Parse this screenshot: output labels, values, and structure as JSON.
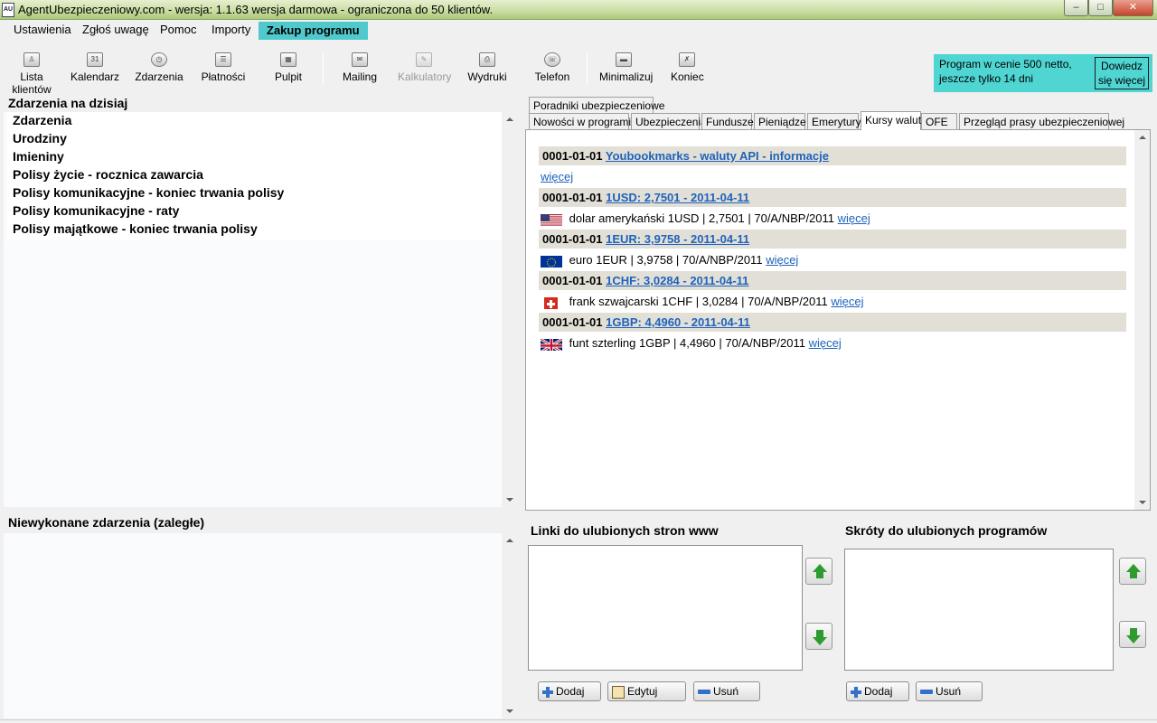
{
  "window": {
    "icon_label": "AU",
    "title": "AgentUbezpieczeniowy.com - wersja: 1.1.63 wersja darmowa - ograniczona do 50 klientów."
  },
  "menu": {
    "items": [
      "Ustawienia",
      "Zgłoś uwagę",
      "Pomoc",
      "Importy",
      "Zakup programu"
    ]
  },
  "toolbar": {
    "items": [
      {
        "label": "Lista klientów",
        "icon": "clients-icon",
        "enabled": true
      },
      {
        "label": "Kalendarz",
        "icon": "calendar-icon",
        "enabled": true
      },
      {
        "label": "Zdarzenia",
        "icon": "events-icon",
        "enabled": true
      },
      {
        "label": "Płatności",
        "icon": "payments-icon",
        "enabled": true
      },
      {
        "label": "Pulpit",
        "icon": "desktop-icon",
        "enabled": true
      },
      {
        "label": "Mailing",
        "icon": "mailing-icon",
        "enabled": true
      },
      {
        "label": "Kalkulatory",
        "icon": "calculator-icon",
        "enabled": false
      },
      {
        "label": "Wydruki",
        "icon": "print-icon",
        "enabled": true
      },
      {
        "label": "Telefon",
        "icon": "phone-icon",
        "enabled": true
      },
      {
        "label": "Minimalizuj",
        "icon": "minimize-icon",
        "enabled": true
      },
      {
        "label": "Koniec",
        "icon": "exit-icon",
        "enabled": true
      }
    ],
    "calendar_icon_text": "31"
  },
  "promo": {
    "line1": "Program w cenie 500 netto,",
    "line2": "jeszcze tylko 14 dni",
    "button_line1": "Dowiedz",
    "button_line2": "się więcej"
  },
  "today": {
    "title": "Zdarzenia na dzisiaj",
    "items": [
      "Zdarzenia",
      "Urodziny",
      "Imieniny",
      "Polisy życie - rocznica zawarcia",
      "Polisy komunikacyjne - koniec trwania polisy",
      "Polisy komunikacyjne - raty",
      "Polisy majątkowe - koniec trwania polisy"
    ]
  },
  "overdue": {
    "title": "Niewykonane zdarzenia (zaległe)"
  },
  "tabs": {
    "row1": [
      "Poradniki ubezpieczeniowe"
    ],
    "row2": [
      "Nowości w programie",
      "Ubezpieczenia",
      "Fundusze",
      "Pieniądze",
      "Emerytury",
      "Kursy walut",
      "OFE",
      "Przegląd prasy ubezpieczeniowej"
    ],
    "active": "Kursy walut"
  },
  "news": {
    "intro": {
      "date": "0001-01-01",
      "link": "Youbookmarks - waluty API - informacje",
      "more": "więcej"
    },
    "rates": [
      {
        "date": "0001-01-01",
        "link": "1USD: 2,7501 - 2011-04-11",
        "flag": "us-flag-icon",
        "text": "dolar amerykański 1USD | 2,7501 | 70/A/NBP/2011",
        "more": "więcej"
      },
      {
        "date": "0001-01-01",
        "link": "1EUR: 3,9758 - 2011-04-11",
        "flag": "eu-flag-icon",
        "text": "euro 1EUR | 3,9758 | 70/A/NBP/2011",
        "more": "więcej"
      },
      {
        "date": "0001-01-01",
        "link": "1CHF: 3,0284 - 2011-04-11",
        "flag": "ch-flag-icon",
        "text": "frank szwajcarski 1CHF | 3,0284 | 70/A/NBP/2011",
        "more": "więcej"
      },
      {
        "date": "0001-01-01",
        "link": "1GBP: 4,4960 - 2011-04-11",
        "flag": "gb-flag-icon",
        "text": "funt szterling 1GBP | 4,4960 | 70/A/NBP/2011",
        "more": "więcej"
      }
    ]
  },
  "links": {
    "title": "Linki do ulubionych stron www",
    "add": "Dodaj",
    "edit": "Edytuj",
    "remove": "Usuń"
  },
  "shortcuts": {
    "title": "Skróty do ulubionych programów",
    "add": "Dodaj",
    "remove": "Usuń"
  }
}
